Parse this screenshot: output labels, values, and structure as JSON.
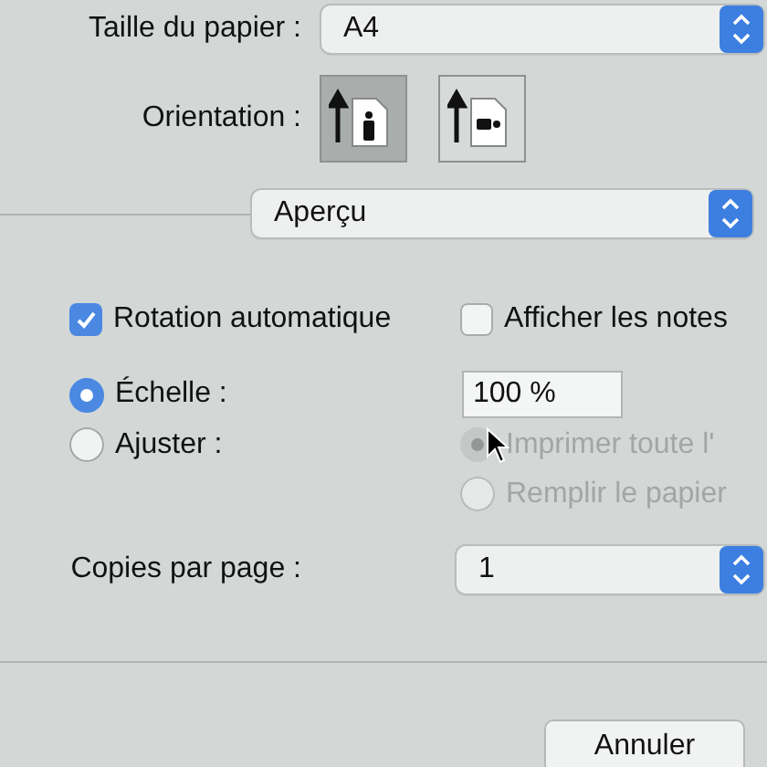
{
  "paper_size": {
    "label": "Taille du papier :",
    "value": "A4"
  },
  "orientation": {
    "label": "Orientation :",
    "options": [
      {
        "kind": "portrait",
        "selected": true
      },
      {
        "kind": "landscape",
        "selected": false
      }
    ]
  },
  "app_menu": {
    "value": "Aperçu"
  },
  "checkboxes": [
    {
      "label": "Rotation automatique",
      "checked": true
    },
    {
      "label": "Afficher les notes",
      "checked": false
    }
  ],
  "scale_modes": [
    {
      "label": "Échelle :",
      "selected": true
    },
    {
      "label": "Ajuster :",
      "selected": false
    }
  ],
  "scale_field": {
    "value": "100 %"
  },
  "fit_options": [
    {
      "label": "Imprimer toute l'",
      "selected": true,
      "disabled": true
    },
    {
      "label": "Remplir le papier",
      "selected": false,
      "disabled": true
    }
  ],
  "copies_per_page": {
    "label": "Copies par page :",
    "value": "1"
  },
  "buttons": [
    "Annuler"
  ]
}
